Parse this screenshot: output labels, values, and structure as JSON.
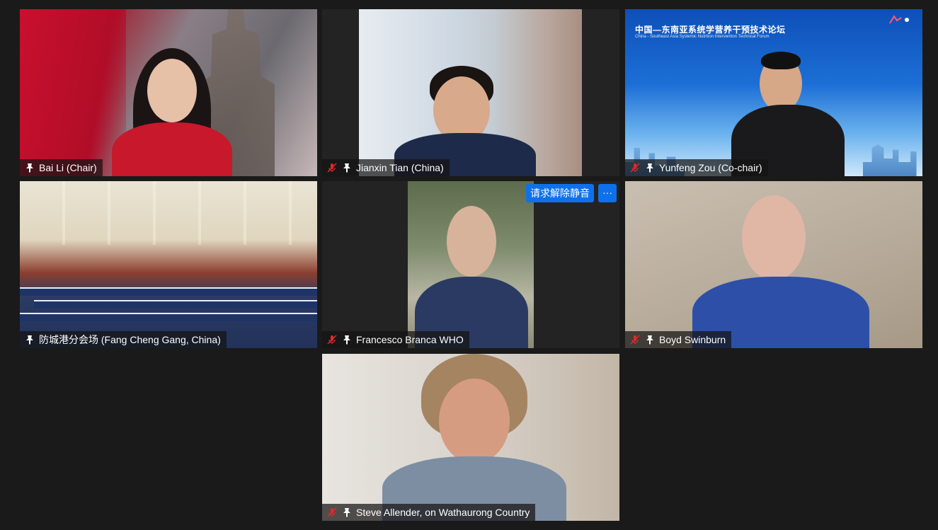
{
  "meeting": {
    "participants": [
      {
        "name": "Bai Li (Chair)",
        "muted": false,
        "pinned": true
      },
      {
        "name": "Jianxin Tian (China)",
        "muted": true,
        "pinned": true
      },
      {
        "name": "Yunfeng Zou (Co-chair)",
        "muted": true,
        "pinned": true
      },
      {
        "name": "防城港分会场 (Fang Cheng Gang, China)",
        "muted": false,
        "pinned": true
      },
      {
        "name": "Francesco Branca WHO",
        "muted": true,
        "pinned": true
      },
      {
        "name": "Boyd Swinburn",
        "muted": true,
        "pinned": true
      },
      {
        "name": "Steve Allender, on Wathaurong Country",
        "muted": true,
        "pinned": true
      }
    ],
    "tile_actions": {
      "unmute_request_label": "请求解除静音",
      "more_label": "···"
    },
    "banner": {
      "title": "中国—东南亚系统学营养干预技术论坛",
      "subtitle": "China - Southeast Asia Systemic Nutrition Intervention Technical Forum"
    }
  },
  "colors": {
    "background": "#1a1a1a",
    "accent_button": "#0e71eb",
    "muted_icon": "#e02828"
  },
  "icons": {
    "pin": "pin-icon",
    "muted_mic": "muted-mic-icon",
    "more": "more-options-icon"
  }
}
